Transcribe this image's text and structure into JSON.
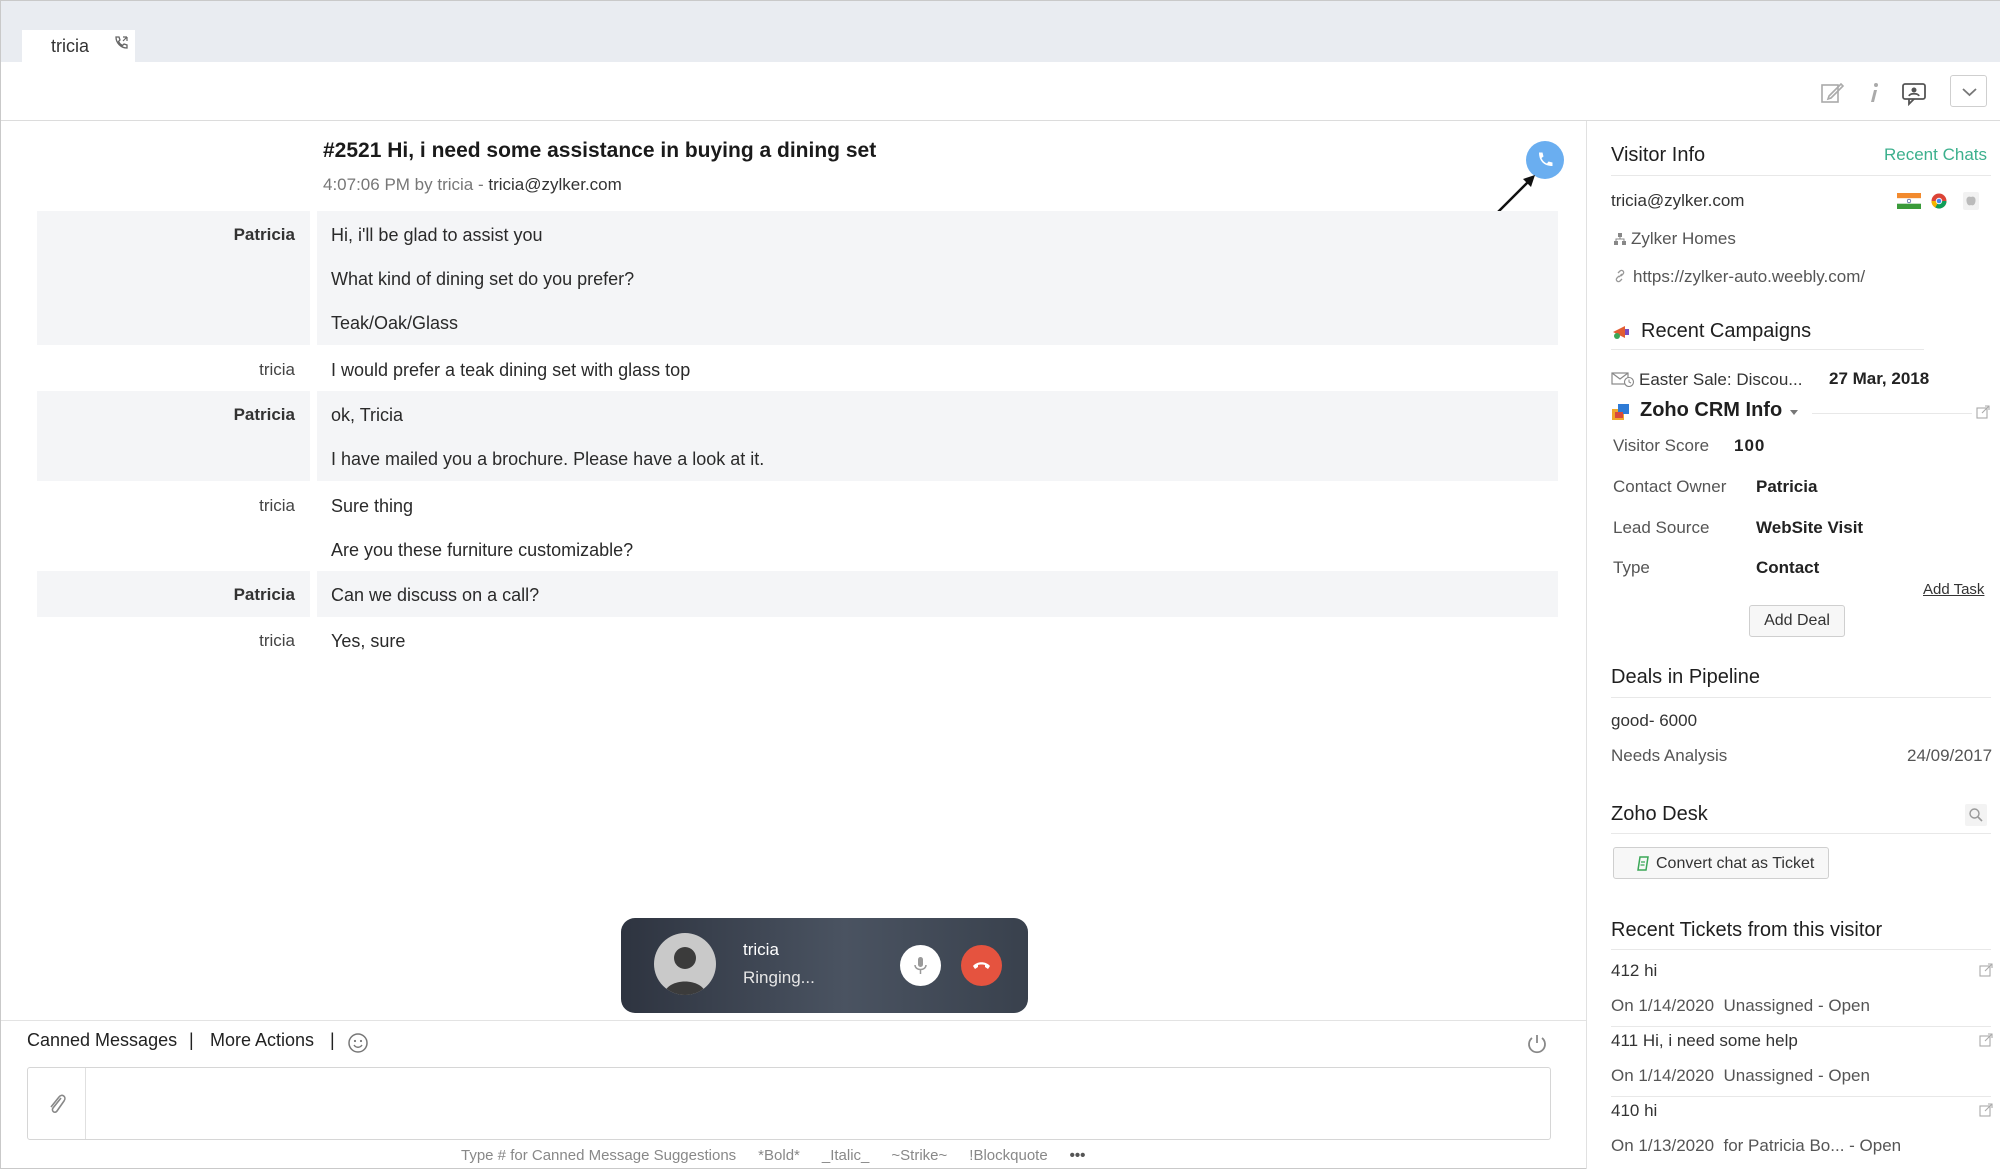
{
  "tab": {
    "label": "tricia"
  },
  "chat": {
    "title": "#2521  Hi, i need some assistance in buying a dining set",
    "meta_time": "4:07:06 PM by tricia - ",
    "meta_email": "tricia@zylker.com",
    "groups": [
      {
        "sender": "Patricia",
        "agent": true,
        "lines": [
          "Hi, i'll be glad to assist you",
          "What kind of dining set do you prefer?",
          "Teak/Oak/Glass"
        ]
      },
      {
        "sender": "tricia",
        "agent": false,
        "lines": [
          "I would prefer a teak dining set with glass top"
        ]
      },
      {
        "sender": "Patricia",
        "agent": true,
        "lines": [
          "ok, Tricia",
          "I have mailed you a brochure. Please have a look at it."
        ]
      },
      {
        "sender": "tricia",
        "agent": false,
        "lines": [
          "Sure thing",
          "Are you these furniture customizable?"
        ]
      },
      {
        "sender": "Patricia",
        "agent": true,
        "lines": [
          "Can we discuss on a call?"
        ]
      },
      {
        "sender": "tricia",
        "agent": false,
        "lines": [
          "Yes, sure"
        ]
      }
    ]
  },
  "call_overlay": {
    "name": "tricia",
    "status": "Ringing..."
  },
  "composer": {
    "canned_label": "Canned Messages",
    "separator": "|",
    "more_label": "More Actions",
    "placeholder": "",
    "hints": [
      "Type # for Canned Message Suggestions",
      "*Bold*",
      "_Italic_",
      "~Strike~",
      "!Blockquote",
      "•••"
    ]
  },
  "panel": {
    "visitor_info_title": "Visitor Info",
    "recent_chats_label": "Recent Chats",
    "email": "tricia@zylker.com",
    "company": "Zylker Homes",
    "url": "https://zylker-auto.weebly.com/",
    "campaigns_title": "Recent Campaigns",
    "campaign_name": "Easter Sale: Discou...",
    "campaign_date": "27 Mar, 2018",
    "crm_title": "Zoho CRM Info",
    "crm_rows": [
      {
        "label": "Visitor Score",
        "value": "100"
      },
      {
        "label": "Contact Owner",
        "value": "Patricia"
      },
      {
        "label": "Lead Source",
        "value": "WebSite Visit"
      },
      {
        "label": "Type",
        "value": "Contact"
      }
    ],
    "add_task_label": "Add Task",
    "add_deal_label": "Add Deal",
    "deals_title": "Deals in Pipeline",
    "deal_name": "good- 6000",
    "deal_stage": "Needs Analysis",
    "deal_date": "24/09/2017",
    "desk_title": "Zoho Desk",
    "convert_label": "Convert chat as Ticket",
    "tickets_title": "Recent Tickets from this visitor",
    "tickets": [
      {
        "title": "412  hi",
        "date": "On 1/14/2020",
        "assignee": "Unassigned",
        "status": " - Open"
      },
      {
        "title": "411  Hi, i need some help",
        "date": "On 1/14/2020",
        "assignee": "Unassigned",
        "status": " - Open"
      },
      {
        "title": "410  hi",
        "date": "On 1/13/2020",
        "assignee": "for Patricia Bo...",
        "status": " - Open"
      }
    ]
  },
  "colors": {
    "accent_green": "#3cb08d",
    "call_blue": "#6aaef0",
    "end_call_red": "#e5533f"
  }
}
